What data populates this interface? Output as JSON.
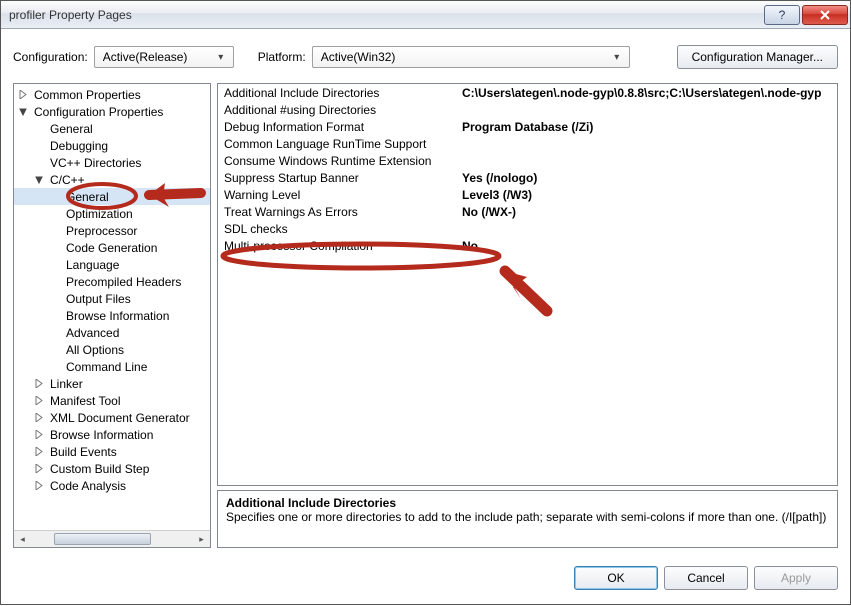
{
  "window": {
    "title": "profiler Property Pages"
  },
  "configbar": {
    "config_label": "Configuration:",
    "config_value": "Active(Release)",
    "platform_label": "Platform:",
    "platform_value": "Active(Win32)",
    "manager_btn": "Configuration Manager..."
  },
  "tree": {
    "common": "Common Properties",
    "configprops": "Configuration Properties",
    "cp": {
      "general": "General",
      "debugging": "Debugging",
      "vcdirs": "VC++ Directories",
      "ccpp": "C/C++",
      "ccpp_children": {
        "general": "General",
        "optimization": "Optimization",
        "preprocessor": "Preprocessor",
        "codegen": "Code Generation",
        "language": "Language",
        "pch": "Precompiled Headers",
        "outfiles": "Output Files",
        "browseinfo": "Browse Information",
        "advanced": "Advanced",
        "allopts": "All Options",
        "cmdline": "Command Line"
      },
      "linker": "Linker",
      "manifest": "Manifest Tool",
      "xmldoc": "XML Document Generator",
      "browseinfo": "Browse Information",
      "buildevents": "Build Events",
      "custombuild": "Custom Build Step",
      "codeanalysis": "Code Analysis"
    }
  },
  "props": [
    {
      "name": "Additional Include Directories",
      "value": "C:\\Users\\ategen\\.node-gyp\\0.8.8\\src;C:\\Users\\ategen\\.node-gyp"
    },
    {
      "name": "Additional #using Directories",
      "value": ""
    },
    {
      "name": "Debug Information Format",
      "value": "Program Database (/Zi)"
    },
    {
      "name": "Common Language RunTime Support",
      "value": ""
    },
    {
      "name": "Consume Windows Runtime Extension",
      "value": ""
    },
    {
      "name": "Suppress Startup Banner",
      "value": "Yes (/nologo)"
    },
    {
      "name": "Warning Level",
      "value": "Level3 (/W3)"
    },
    {
      "name": "Treat Warnings As Errors",
      "value": "No (/WX-)"
    },
    {
      "name": "SDL checks",
      "value": ""
    },
    {
      "name": "Multi-processor Compilation",
      "value": "No"
    }
  ],
  "desc": {
    "heading": "Additional Include Directories",
    "body": "Specifies one or more directories to add to the include path; separate with semi-colons if more than one. (/I[path])"
  },
  "footer": {
    "ok": "OK",
    "cancel": "Cancel",
    "apply": "Apply"
  }
}
